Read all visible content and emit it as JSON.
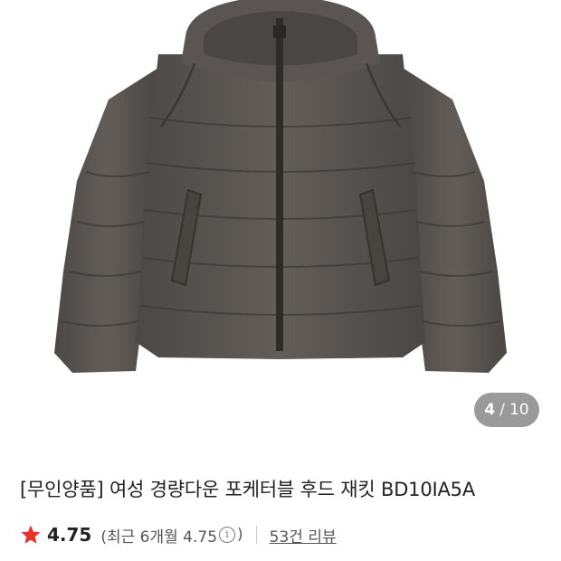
{
  "gallery": {
    "current": "4",
    "separator": "/",
    "total": "10",
    "image_icon": "puffer-jacket-photo"
  },
  "product": {
    "title": "[무인양품] 여성 경량다운 포케터블 후드 재킷 BD10IA5A"
  },
  "rating": {
    "star_icon": "star-icon",
    "star_color": "#e8322b",
    "score": "4.75",
    "recent_prefix": "(최근 6개월 4.75",
    "info_glyph": "i",
    "recent_suffix": ")",
    "review_link": "53건 리뷰"
  },
  "colors": {
    "jacket": "#57524f",
    "counter_bg": "#9a9a9a"
  }
}
